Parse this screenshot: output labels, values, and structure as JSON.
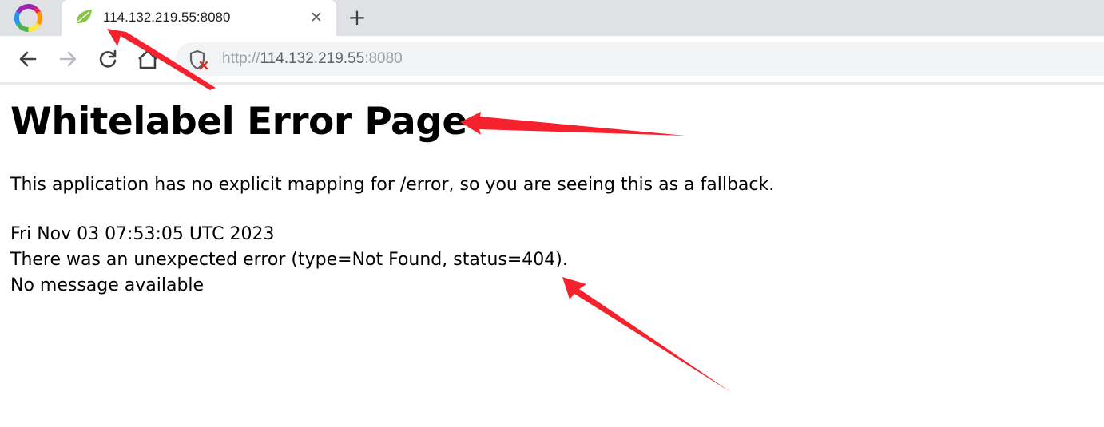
{
  "browser": {
    "tab_title": "114.132.219.55:8080",
    "close_glyph": "✕",
    "new_tab_glyph": "+",
    "url": {
      "scheme": "http://",
      "host": "114.132.219.55",
      "port": ":8080"
    }
  },
  "page": {
    "heading": "Whitelabel Error Page",
    "description": "This application has no explicit mapping for /error, so you are seeing this as a fallback.",
    "timestamp": "Fri Nov 03 07:53:05 UTC 2023",
    "error_line": "There was an unexpected error (type=Not Found, status=404).",
    "message_line": "No message available"
  },
  "icons": {
    "browser_logo": "browser-logo-icon",
    "favicon": "spring-leaf-icon",
    "back": "arrow-left-icon",
    "forward": "arrow-right-icon",
    "reload": "reload-icon",
    "home": "home-icon",
    "security": "not-secure-shield-icon"
  },
  "colors": {
    "annotation": "#f5222d",
    "tabstrip": "#dfe1e5",
    "address_bar": "#f1f3f4",
    "favicon": "#8bc34a"
  }
}
